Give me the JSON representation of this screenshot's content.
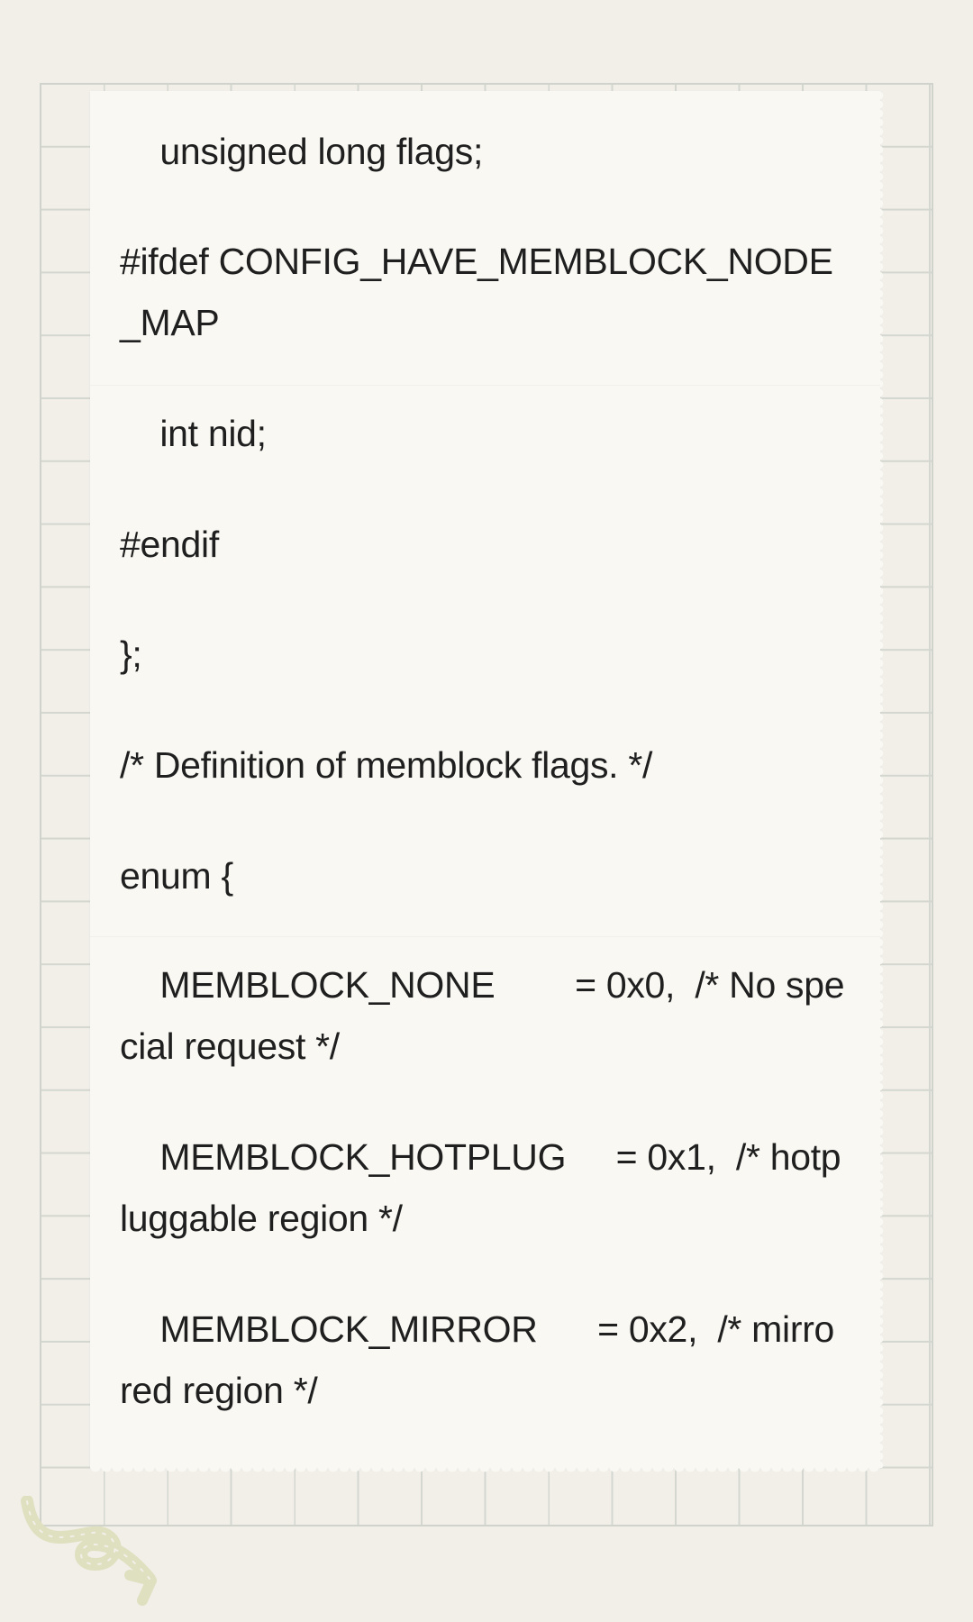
{
  "code_lines": [
    "    unsigned long flags;",
    "#ifdef CONFIG_HAVE_MEMBLOCK_NODE",
    "_MAP",
    "    int nid;",
    "#endif",
    "};",
    "/* Definition of memblock flags. */",
    "enum {",
    "    MEMBLOCK_NONE        = 0x0,  /* No spe",
    "cial request */",
    "    MEMBLOCK_HOTPLUG     = 0x1,  /* hotp",
    "luggable region */",
    "    MEMBLOCK_MIRROR      = 0x2,  /* mirro",
    "red region */"
  ],
  "icons": {
    "decoration": "squiggle-arrow-icon"
  },
  "colors": {
    "background": "#f1efe8",
    "paper": "#f9f8f3",
    "grid": "#d3d7cf",
    "text": "#1f1f1f",
    "doodle": "#dfe0c0"
  }
}
